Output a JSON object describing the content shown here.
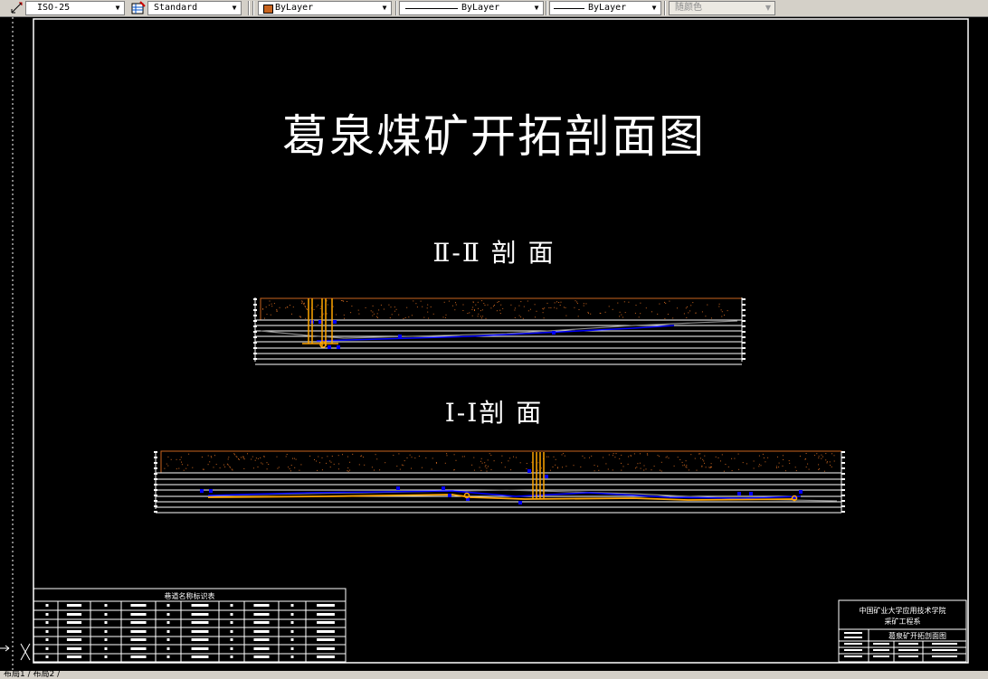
{
  "toolbar": {
    "dimstyle": "ISO-25",
    "tablestyle": "Standard",
    "color": "ByLayer",
    "linetype": "ByLayer",
    "lineweight": "ByLayer",
    "plotstyle": "随颜色"
  },
  "drawing": {
    "title": "葛泉煤矿开拓剖面图",
    "section2_label": "Ⅱ-Ⅱ 剖  面",
    "section1_label": "Ⅰ-Ⅰ剖  面",
    "legend_table_title": "巷道名称标识表",
    "titleblock": {
      "institution": "中国矿业大学应用技术学院",
      "department": "采矿工程系",
      "drawing_name": "葛泉矿开拓剖面图"
    }
  },
  "statusbar": {
    "layout_tabs": "布局1 / 布局2 /"
  },
  "colors": {
    "strata": "#c8641e",
    "roadway": "#0000ff",
    "shaft": "#ffa500",
    "terrain": "#8a8a8a",
    "lines": "#ffffff"
  }
}
